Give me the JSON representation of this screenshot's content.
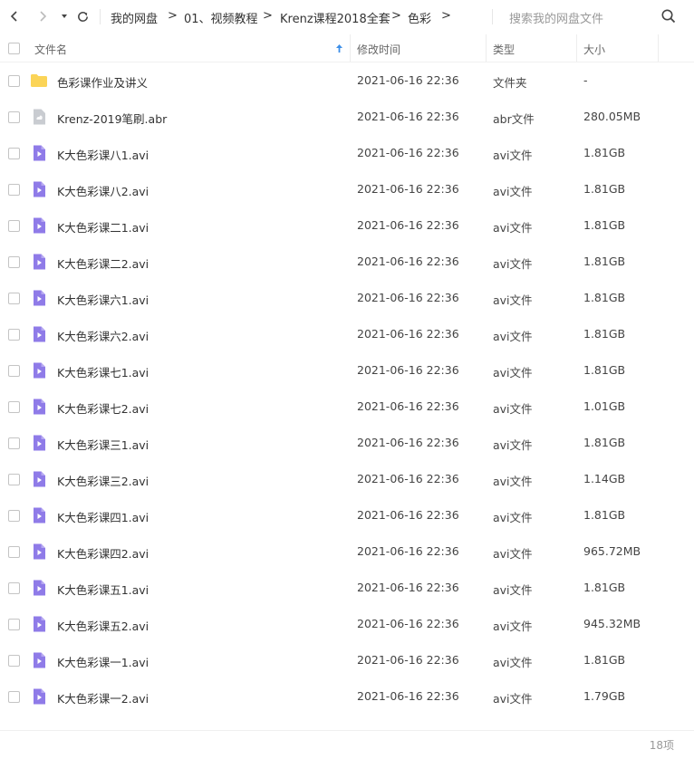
{
  "nav": {
    "back_icon": "chevron-left-icon",
    "forward_icon": "chevron-right-icon",
    "dropdown_icon": "caret-down-icon",
    "refresh_icon": "refresh-icon"
  },
  "breadcrumb": [
    "我的网盘",
    "01、视频教程",
    "Krenz课程2018全套",
    "色彩"
  ],
  "breadcrumb_separator": ">",
  "search": {
    "placeholder": "搜索我的网盘文件",
    "icon": "search-icon"
  },
  "columns": {
    "name": "文件名",
    "modified": "修改时间",
    "type": "类型",
    "size": "大小"
  },
  "sort": {
    "column": "name",
    "direction": "ascending",
    "icon": "arrow-up-icon",
    "color": "#3d8fe8"
  },
  "colors": {
    "folder": "#fbd457",
    "video": "#8f7be8",
    "brush": "#c9ccd1"
  },
  "files": [
    {
      "name": "色彩课作业及讲义",
      "date": "2021-06-16 22:36",
      "type": "文件夹",
      "size": "-",
      "icon": "folder-icon"
    },
    {
      "name": "Krenz-2019笔刷.abr",
      "date": "2021-06-16 22:36",
      "type": "abr文件",
      "size": "280.05MB",
      "icon": "brush-file-icon"
    },
    {
      "name": "K大色彩课八1.avi",
      "date": "2021-06-16 22:36",
      "type": "avi文件",
      "size": "1.81GB",
      "icon": "video-file-icon"
    },
    {
      "name": "K大色彩课八2.avi",
      "date": "2021-06-16 22:36",
      "type": "avi文件",
      "size": "1.81GB",
      "icon": "video-file-icon"
    },
    {
      "name": "K大色彩课二1.avi",
      "date": "2021-06-16 22:36",
      "type": "avi文件",
      "size": "1.81GB",
      "icon": "video-file-icon"
    },
    {
      "name": "K大色彩课二2.avi",
      "date": "2021-06-16 22:36",
      "type": "avi文件",
      "size": "1.81GB",
      "icon": "video-file-icon"
    },
    {
      "name": "K大色彩课六1.avi",
      "date": "2021-06-16 22:36",
      "type": "avi文件",
      "size": "1.81GB",
      "icon": "video-file-icon"
    },
    {
      "name": "K大色彩课六2.avi",
      "date": "2021-06-16 22:36",
      "type": "avi文件",
      "size": "1.81GB",
      "icon": "video-file-icon"
    },
    {
      "name": "K大色彩课七1.avi",
      "date": "2021-06-16 22:36",
      "type": "avi文件",
      "size": "1.81GB",
      "icon": "video-file-icon"
    },
    {
      "name": "K大色彩课七2.avi",
      "date": "2021-06-16 22:36",
      "type": "avi文件",
      "size": "1.01GB",
      "icon": "video-file-icon"
    },
    {
      "name": "K大色彩课三1.avi",
      "date": "2021-06-16 22:36",
      "type": "avi文件",
      "size": "1.81GB",
      "icon": "video-file-icon"
    },
    {
      "name": "K大色彩课三2.avi",
      "date": "2021-06-16 22:36",
      "type": "avi文件",
      "size": "1.14GB",
      "icon": "video-file-icon"
    },
    {
      "name": "K大色彩课四1.avi",
      "date": "2021-06-16 22:36",
      "type": "avi文件",
      "size": "1.81GB",
      "icon": "video-file-icon"
    },
    {
      "name": "K大色彩课四2.avi",
      "date": "2021-06-16 22:36",
      "type": "avi文件",
      "size": "965.72MB",
      "icon": "video-file-icon"
    },
    {
      "name": "K大色彩课五1.avi",
      "date": "2021-06-16 22:36",
      "type": "avi文件",
      "size": "1.81GB",
      "icon": "video-file-icon"
    },
    {
      "name": "K大色彩课五2.avi",
      "date": "2021-06-16 22:36",
      "type": "avi文件",
      "size": "945.32MB",
      "icon": "video-file-icon"
    },
    {
      "name": "K大色彩课一1.avi",
      "date": "2021-06-16 22:36",
      "type": "avi文件",
      "size": "1.81GB",
      "icon": "video-file-icon"
    },
    {
      "name": "K大色彩课一2.avi",
      "date": "2021-06-16 22:36",
      "type": "avi文件",
      "size": "1.79GB",
      "icon": "video-file-icon"
    }
  ],
  "footer": {
    "count": "18项"
  }
}
